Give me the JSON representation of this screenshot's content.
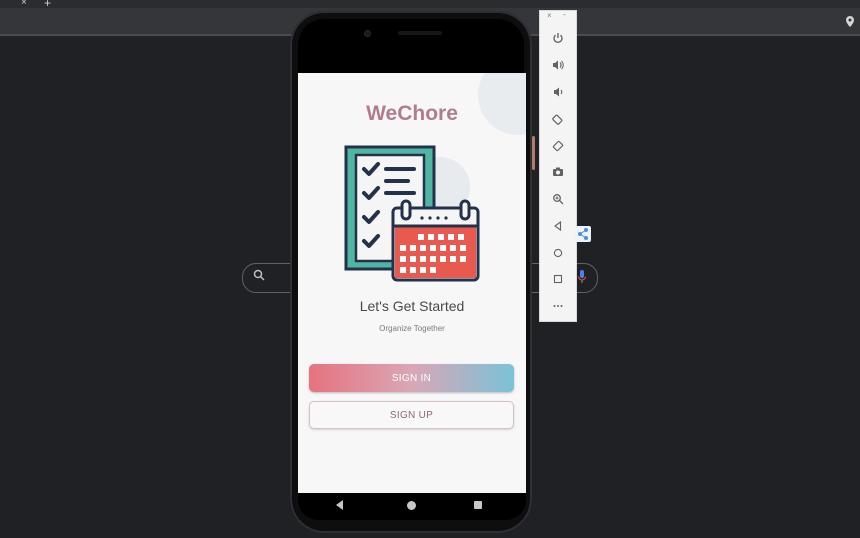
{
  "browser": {
    "tab_close_icon": "close-icon",
    "new_tab_icon": "plus-icon",
    "tab_close_glyph": "×",
    "new_tab_glyph": "+",
    "location_icon": "location-pin-icon",
    "search_icon": "search-icon",
    "mic_icon": "microphone-icon"
  },
  "app": {
    "title": "WeChore",
    "headline": "Let's Get Started",
    "subline": "Organize Together",
    "sign_in_label": "SIGN IN",
    "sign_up_label": "SIGN UP",
    "illustration": "checklist-calendar-illustration"
  },
  "android_nav": {
    "items": [
      "back-icon",
      "home-icon",
      "recents-icon"
    ]
  },
  "emulator_toolbar": {
    "close_glyph": "×",
    "minimize_glyph": "-",
    "items": [
      "power-icon",
      "volume-up-icon",
      "volume-down-icon",
      "rotate-left-icon",
      "rotate-right-icon",
      "camera-icon",
      "zoom-icon",
      "back-icon",
      "home-icon",
      "overview-icon",
      "more-icon"
    ]
  },
  "colors": {
    "title": "#b07d8d",
    "sign_in_gradient_start": "#e7727f",
    "sign_in_gradient_end": "#7bc2d8",
    "calendar_red": "#e85a4f",
    "clipboard_teal": "#4fb6a3",
    "navy": "#23324a"
  }
}
